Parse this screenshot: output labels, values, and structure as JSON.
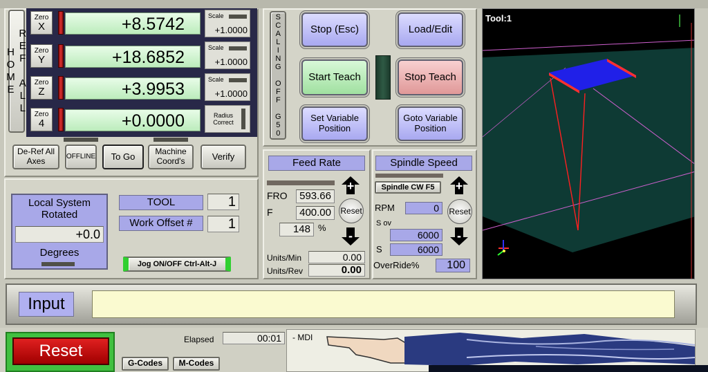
{
  "dro": {
    "ref_all_home": "REF ALL HOME",
    "axes": [
      {
        "zero_label": "Zero",
        "axis": "X",
        "value": "+8.5742",
        "scale_label": "Scale",
        "scale_value": "+1.0000"
      },
      {
        "zero_label": "Zero",
        "axis": "Y",
        "value": "+18.6852",
        "scale_label": "Scale",
        "scale_value": "+1.0000"
      },
      {
        "zero_label": "Zero",
        "axis": "Z",
        "value": "+3.9953",
        "scale_label": "Scale",
        "scale_value": "+1.0000"
      },
      {
        "zero_label": "Zero",
        "axis": "4",
        "value": "+0.0000",
        "scale_label": "Radius Correct"
      }
    ],
    "buttons": {
      "deref": "De-Ref All Axes",
      "offline": "OFFLINE",
      "togo": "To Go",
      "machine": "Machine Coord's",
      "verify": "Verify"
    }
  },
  "scaling": {
    "vertical_text": "SCALING OFF G50"
  },
  "teach": {
    "stop": "Stop (Esc)",
    "load_edit": "Load/Edit",
    "start_teach": "Start Teach",
    "stop_teach": "Stop Teach",
    "set_var": "Set Variable Position",
    "goto_var": "Goto Variable Position"
  },
  "local": {
    "title": "Local System Rotated",
    "value": "+0.0",
    "degrees": "Degrees",
    "tool_label": "TOOL",
    "tool_value": "1",
    "offset_label": "Work Offset #",
    "offset_value": "1",
    "jog": "Jog ON/OFF Ctrl-Alt-J"
  },
  "feed": {
    "title": "Feed Rate",
    "fro_label": "FRO",
    "fro_value": "593.66",
    "f_label": "F",
    "f_value": "400.00",
    "pct_value": "148",
    "pct_unit": "%",
    "reset": "Reset",
    "plus": "+",
    "minus": "-",
    "units_min_label": "Units/Min",
    "units_min_value": "0.00",
    "units_rev_label": "Units/Rev",
    "units_rev_value": "0.00"
  },
  "spindle": {
    "title": "Spindle Speed",
    "cw": "Spindle CW F5",
    "rpm_label": "RPM",
    "rpm_value": "0",
    "sov_label": "S ov",
    "sov_value": "6000",
    "s_label": "S",
    "s_value": "6000",
    "override_label": "OverRide%",
    "override_value": "100",
    "reset": "Reset",
    "plus": "+",
    "minus": "-"
  },
  "toolpath": {
    "tool_label": "Tool:1"
  },
  "input": {
    "label": "Input",
    "value": ""
  },
  "bottom": {
    "reset": "Reset",
    "elapsed_label": "Elapsed",
    "elapsed_value": "00:01",
    "gcodes": "G-Codes",
    "mcodes": "M-Codes",
    "mdi": "- MDI"
  }
}
